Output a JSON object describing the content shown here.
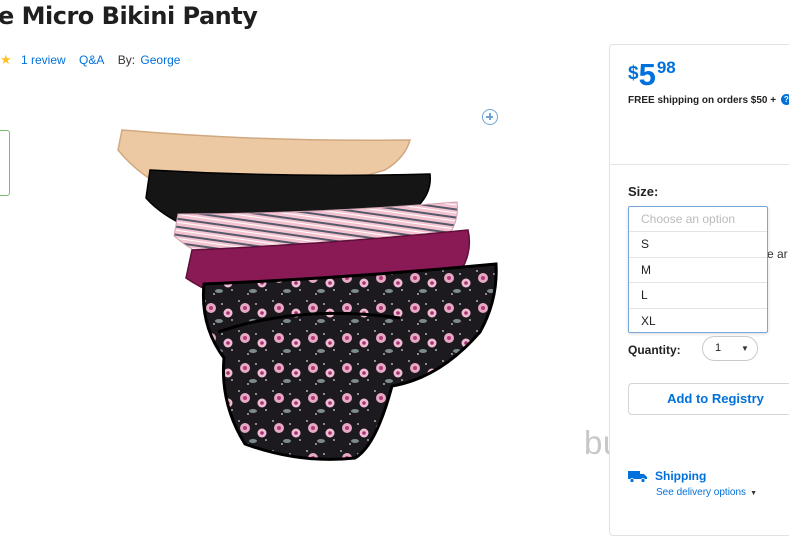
{
  "product": {
    "title": "e Micro Bikini Panty",
    "reviews_link": "1 review",
    "qa_link": "Q&A",
    "by_label": "By:",
    "brand": "George"
  },
  "price": {
    "currency": "$",
    "dollars": "5",
    "cents": "98"
  },
  "shipping_note": "FREE shipping on orders $50 +",
  "size": {
    "label": "Size:",
    "placeholder": "Choose an option",
    "options": [
      "S",
      "M",
      "L",
      "XL"
    ]
  },
  "obscured_text": "e ar",
  "quantity": {
    "label": "Quantity:",
    "value": "1"
  },
  "registry_button": "Add to Registry",
  "shipping": {
    "label": "Shipping",
    "link": "See delivery options"
  },
  "watermark": "buy_brands",
  "colors": {
    "accent": "#0071dc",
    "star": "#ffc220",
    "panty_colors": [
      "#ecc9a2",
      "#111111",
      "#f2b8cb",
      "#8a1a56",
      "#1a1a1a"
    ]
  }
}
